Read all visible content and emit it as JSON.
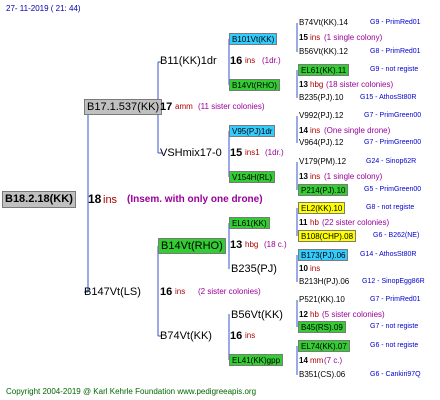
{
  "header": {
    "date": "27-  11-2019  ( 21:  44)"
  },
  "colors": {
    "cyan": "#33ccff",
    "green": "#33cc33",
    "yellow": "#ffff00",
    "grey": "#c0c0c0",
    "line": "#3355cc",
    "red": "#b00000",
    "magenta": "#990099",
    "blue": "#0000cc"
  },
  "root": {
    "name": "B18.2.18(KK)",
    "num": "18",
    "suffix": "ins",
    "note": "(Insem. with only one drone)"
  },
  "gen1": {
    "top": {
      "name": "B17.1.537(KK)",
      "num": "17",
      "suffix": "amm",
      "note": "(11 sister colonies)"
    },
    "bottom": {
      "name": "B147Vt(LS)",
      "num": "16",
      "suffix": "ins",
      "note": "(2 sister colonies)"
    }
  },
  "gen2": [
    {
      "name": "B11(KK)1dr",
      "num": "16",
      "suffix": "ins",
      "note": "(1dr.)"
    },
    {
      "name": "VSHmix17-0",
      "num": "15",
      "suffix": "ins1",
      "note": "(1dr.)"
    },
    {
      "name": "B14Vt(RHO)",
      "num": "13",
      "suffix": "hbg",
      "note": "(18 c.)"
    },
    {
      "name": "B74Vt(KK)",
      "num": "16",
      "suffix": "ins",
      "note": ""
    }
  ],
  "gen3": [
    {
      "name": "B101Vt(KK)",
      "num": "15",
      "suffix": "ins",
      "note": "(1 single colony)"
    },
    {
      "name": "B14Vt(RHO)",
      "num": "13",
      "suffix": "hbg",
      "note": "(18 sister colonies)"
    },
    {
      "name": "V95(PJ)1dr",
      "num": "14",
      "suffix": "ins",
      "note": "(One single drone)"
    },
    {
      "name": "V154H(RL)",
      "num": "13",
      "suffix": "ins",
      "note": "(1 single colony)"
    },
    {
      "name": "EL61(KK)",
      "num": "11",
      "suffix": "hb",
      "note": "(22 sister colonies)"
    },
    {
      "name": "B235(PJ)",
      "num": "10",
      "suffix": "ins",
      "note": ""
    },
    {
      "name": "B56Vt(KK)",
      "num": "12",
      "suffix": "hb",
      "note": "(5 sister colonies)"
    },
    {
      "name": "EL41(KK)gpp",
      "num": "14",
      "suffix": "mm",
      "note": "(7 c.)"
    }
  ],
  "gen4": [
    {
      "name": "B74Vt(KK).14",
      "right": "G9 - PrimRed01"
    },
    {
      "name": "B56Vt(KK).12",
      "right": "G8 - PrimRed01"
    },
    {
      "name": "EL61(KK).11",
      "right": "G9 - not registe"
    },
    {
      "name": "B235(PJ).10",
      "right": "G15 - AthosSt80R"
    },
    {
      "name": "V992(PJ).12",
      "right": "G7 - PrimGreen00"
    },
    {
      "name": "V964(PJ).12",
      "right": "G7 - PrimGreen00"
    },
    {
      "name": "V179(PM).12",
      "right": "G24 - Sinop62R"
    },
    {
      "name": "P214(PJ).10",
      "right": "G5 - PrimGreen00"
    },
    {
      "name": "EL2(KK).10",
      "right": "G8 - not registe"
    },
    {
      "name": "B108(CHP).08",
      "right": "G6 - B262(NE)"
    },
    {
      "name": "B173(PJ).06",
      "right": "G14 - AthosSt80R"
    },
    {
      "name": "B213H(PJ).06",
      "right": "G12 - SinopEgg86R"
    },
    {
      "name": "P521(KK).10",
      "right": "G7 - PrimRed01"
    },
    {
      "name": "B45(RS).09",
      "right": "G7 - not registe"
    },
    {
      "name": "EL74(KK).07",
      "right": "G6 - not registe"
    },
    {
      "name": "B351(CS).06",
      "right": "G6 - Cankiri97Q"
    }
  ],
  "footer": "Copyright 2004-2019 @ Karl Kehrle Foundation    www.pedigreeapis.org"
}
